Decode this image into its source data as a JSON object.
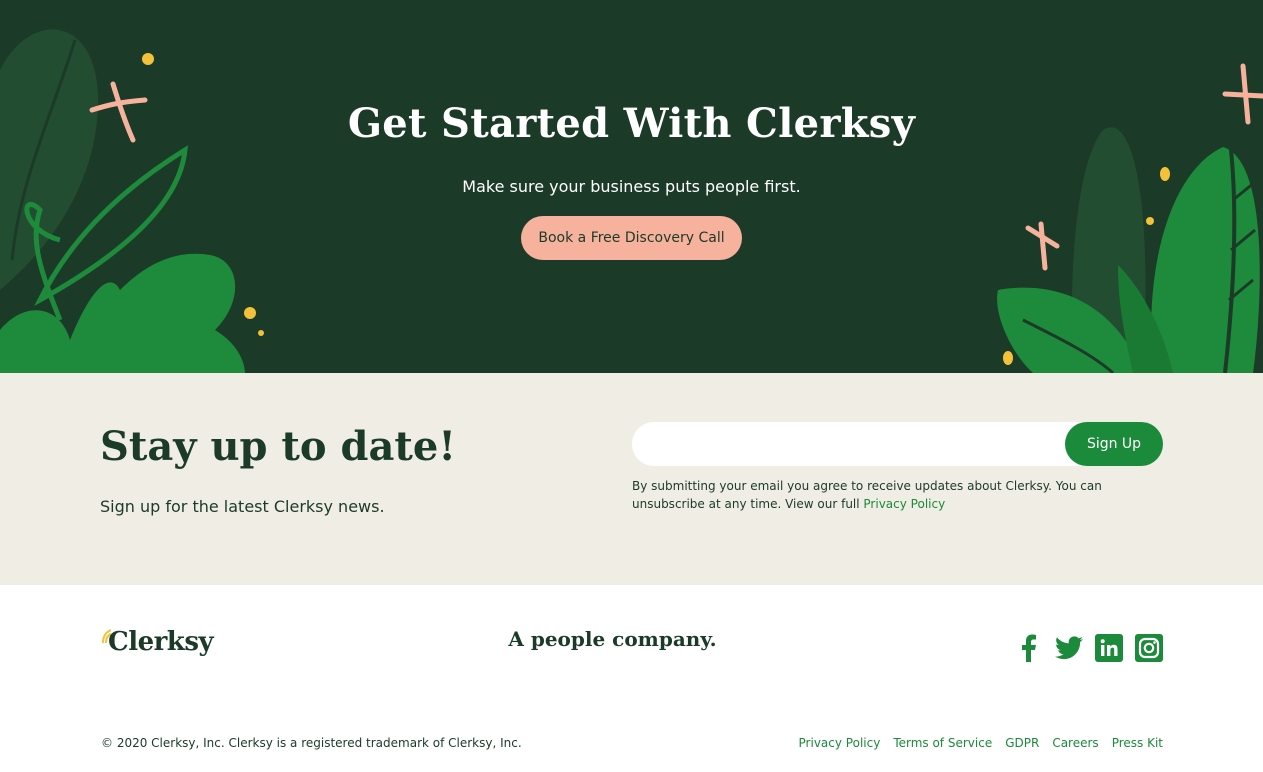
{
  "hero": {
    "title": "Get Started With Clerksy",
    "subtitle": "Make sure your business puts people first.",
    "cta_label": "Book a Free Discovery Call"
  },
  "newsletter": {
    "title": "Stay up to date!",
    "subtitle": "Sign up for the latest Clerksy news.",
    "email_value": "",
    "email_placeholder": "",
    "signup_label": "Sign Up",
    "disclaimer_text": "By submitting your email you agree to receive updates about Clerksy. You can unsubscribe at any time. View our full ",
    "disclaimer_link": "Privacy Policy"
  },
  "footer": {
    "logo_text": "Clerksy",
    "tagline": "A people company.",
    "socials": [
      {
        "icon": "facebook-icon"
      },
      {
        "icon": "twitter-icon"
      },
      {
        "icon": "linkedin-icon"
      },
      {
        "icon": "instagram-icon"
      }
    ],
    "copyright": "© 2020 Clerksy, Inc. Clerksy is a registered trademark of Clerksy, Inc.",
    "links": [
      "Privacy Policy",
      "Terms of Service",
      "GDPR",
      "Careers",
      "Press Kit"
    ]
  },
  "colors": {
    "hero_bg": "#1b3a27",
    "accent_green": "#1b8a3a",
    "cta_peach": "#f7b29d",
    "newsletter_bg": "#f0ede5",
    "star_yellow": "#f4c23a"
  }
}
